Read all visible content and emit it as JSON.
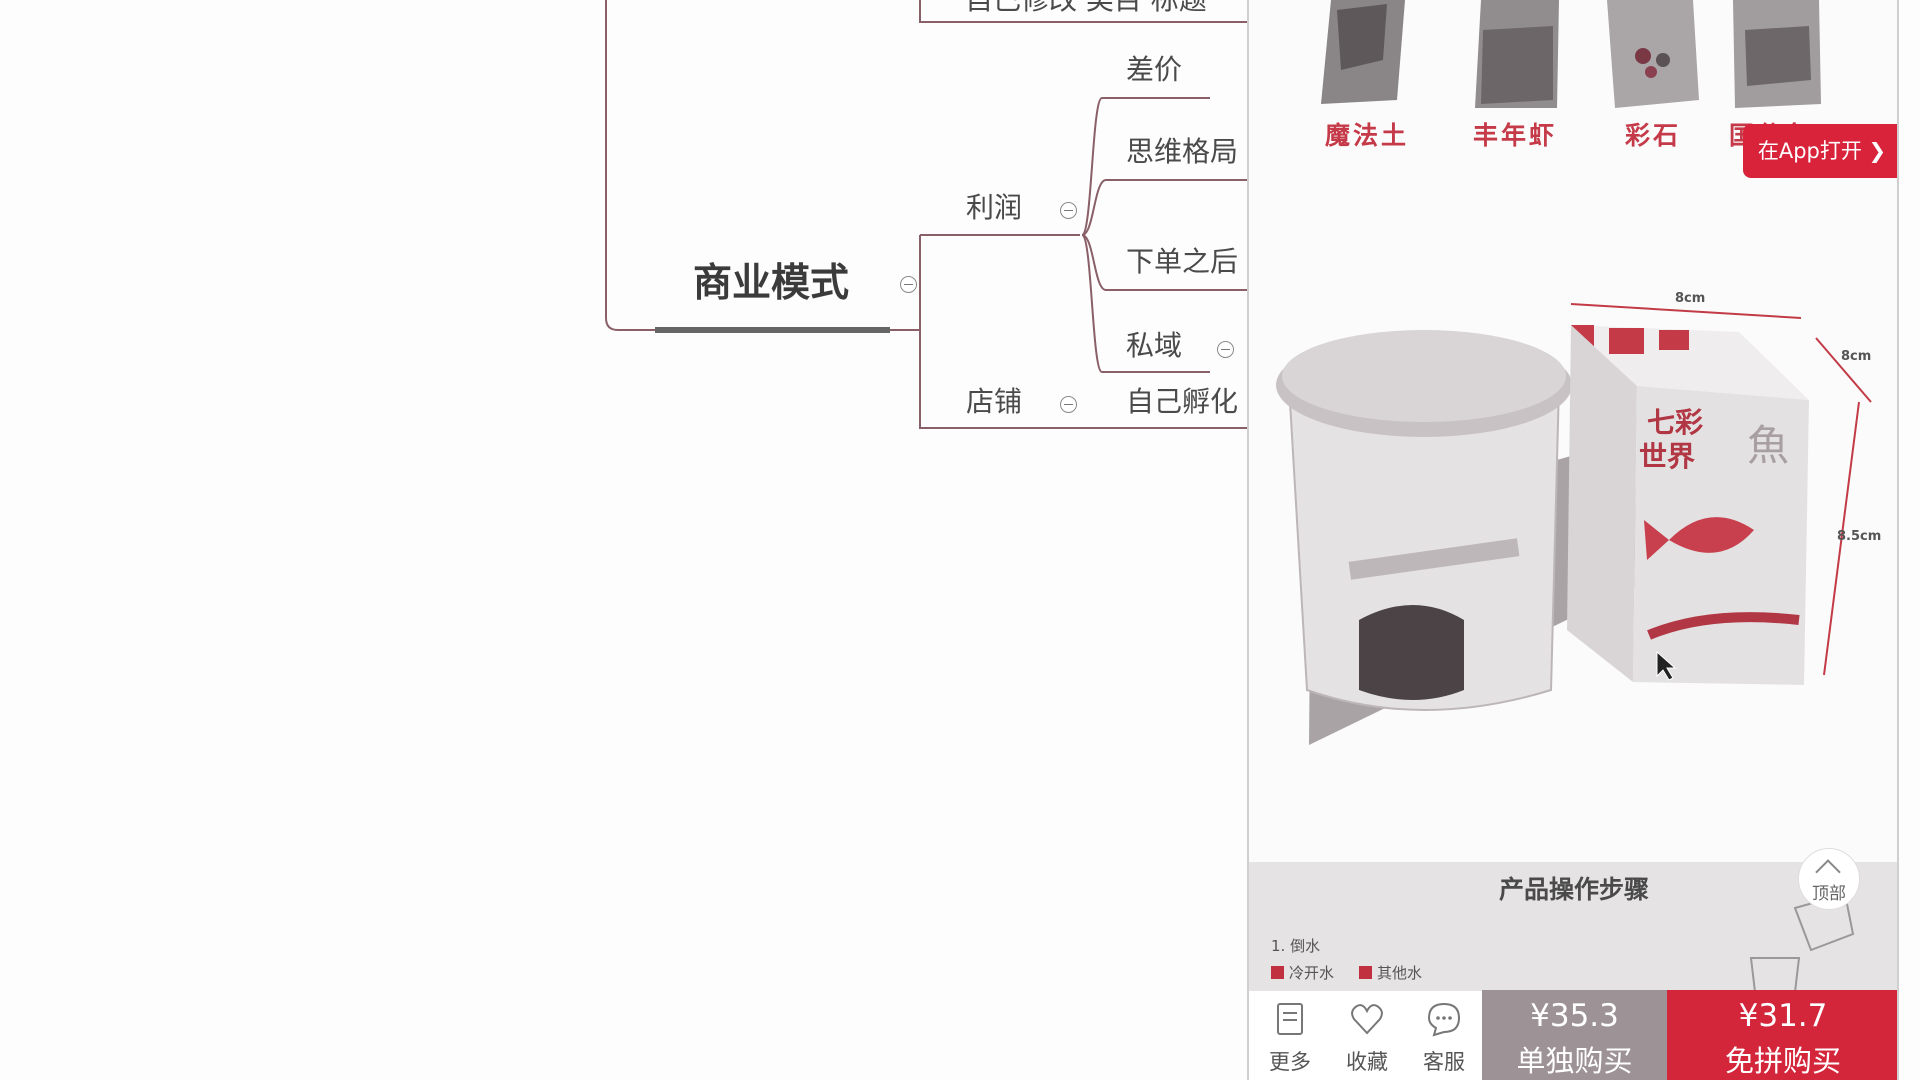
{
  "mindmap": {
    "root": "商业模式",
    "top_cut_text": "自己修改 类目 标题",
    "branches": [
      {
        "label": "利润",
        "children": [
          "差价",
          "思维格局",
          "下单之后",
          "私域"
        ]
      },
      {
        "label": "店铺",
        "children": [
          "自己孵化"
        ]
      }
    ]
  },
  "product_page": {
    "thumb_labels": [
      "魔法土",
      "丰年虾",
      "彩石",
      "国仕鱼"
    ],
    "open_app": "在App打开 ❯",
    "dimensions": [
      "8cm",
      "8cm",
      "8.5cm"
    ],
    "box_text": [
      "七彩",
      "世界",
      "魚"
    ],
    "steps_title": "产品操作步骤",
    "step_1": "1. 倒水",
    "step_options": [
      "冷开水",
      "其他水"
    ],
    "top_button": "顶部",
    "toolbar": {
      "more": "更多",
      "favorite": "收藏",
      "service": "客服"
    },
    "single_price": "¥35.3",
    "single_label": "单独购买",
    "group_price": "¥31.7",
    "group_label": "免拼购买"
  },
  "colors": {
    "accent_red": "#d4263b",
    "single_btn": "#9d9396",
    "mindmap_line": "#7a3340"
  }
}
